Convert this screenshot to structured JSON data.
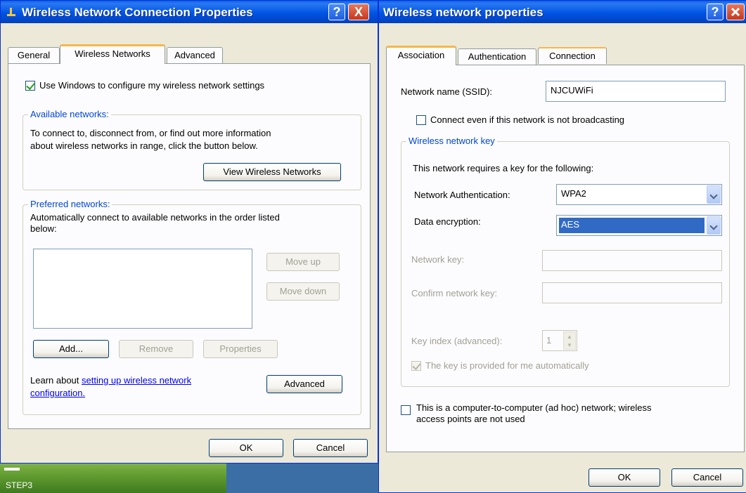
{
  "desktop": {
    "label": "STEP3"
  },
  "left_dialog": {
    "title": "Wireless Network Connection Properties",
    "help": "?",
    "close": "X",
    "tabs": [
      "General",
      "Wireless Networks",
      "Advanced"
    ],
    "use_windows": "Use Windows to configure my wireless network settings",
    "available": {
      "legend": "Available networks:",
      "line1": "To connect to, disconnect from, or find out more information",
      "line2": "about wireless networks in range, click the button below.",
      "view_button": "View Wireless Networks"
    },
    "preferred": {
      "legend": "Preferred networks:",
      "line1": "Automatically connect to available networks in the order listed",
      "line2": "below:",
      "move_up": "Move up",
      "move_down": "Move down",
      "add": "Add...",
      "remove": "Remove",
      "properties": "Properties"
    },
    "learn_prefix": "Learn about ",
    "learn_link1": "setting up wireless network",
    "learn_link2": "configuration.",
    "advanced_button": "Advanced",
    "ok": "OK",
    "cancel": "Cancel"
  },
  "right_dialog": {
    "title": "Wireless network properties",
    "help": "?",
    "tabs": [
      "Association",
      "Authentication",
      "Connection"
    ],
    "ssid_label": "Network name (SSID):",
    "ssid_value": "NJCUWiFi",
    "broadcast": "Connect even if this network is not broadcasting",
    "key_group": {
      "legend": "Wireless network key",
      "requires": "This network requires a key for the following:",
      "auth_label": "Network Authentication:",
      "auth_value": "WPA2",
      "enc_label": "Data encryption:",
      "enc_value": "AES",
      "net_key_label": "Network key:",
      "confirm_key_label": "Confirm network key:",
      "key_index_label": "Key index (advanced):",
      "key_index_value": "1",
      "auto_key": "The key is provided for me automatically"
    },
    "adhoc_line1": "This is a computer-to-computer (ad hoc) network; wireless",
    "adhoc_line2": "access points are not used",
    "ok": "OK",
    "cancel": "Cancel"
  }
}
